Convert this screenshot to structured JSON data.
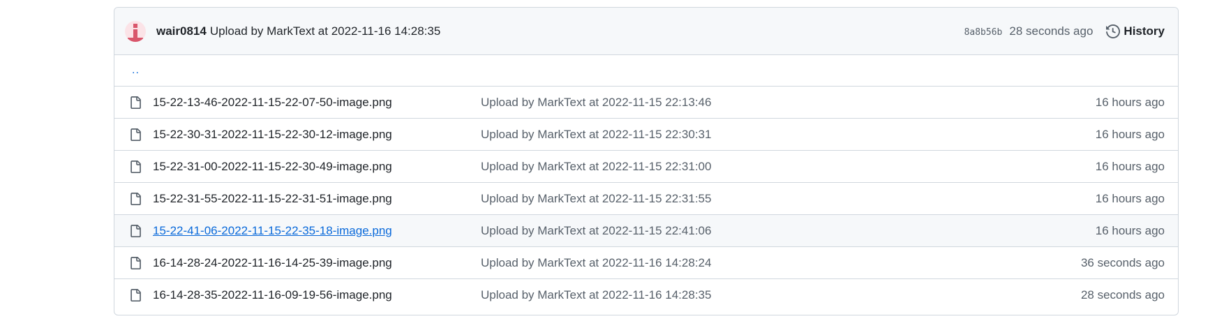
{
  "commit": {
    "author": "wair0814",
    "message": "Upload by MarkText at 2022-11-16 14:28:35",
    "sha": "8a8b56b",
    "age": "28 seconds ago",
    "history_label": "History",
    "avatar_icon": "identicon-avatar"
  },
  "parent_dir": {
    "label": ".."
  },
  "colors": {
    "link": "#0969da",
    "muted": "#57606a",
    "header_bg": "#f6f8fa",
    "border": "#d0d7de",
    "avatar": "#d9566b"
  },
  "files": [
    {
      "name": "15-22-13-46-2022-11-15-22-07-50-image.png",
      "message": "Upload by MarkText at 2022-11-15 22:13:46",
      "age": "16 hours ago",
      "icon": "file-icon"
    },
    {
      "name": "15-22-30-31-2022-11-15-22-30-12-image.png",
      "message": "Upload by MarkText at 2022-11-15 22:30:31",
      "age": "16 hours ago",
      "icon": "file-icon"
    },
    {
      "name": "15-22-31-00-2022-11-15-22-30-49-image.png",
      "message": "Upload by MarkText at 2022-11-15 22:31:00",
      "age": "16 hours ago",
      "icon": "file-icon"
    },
    {
      "name": "15-22-31-55-2022-11-15-22-31-51-image.png",
      "message": "Upload by MarkText at 2022-11-15 22:31:55",
      "age": "16 hours ago",
      "icon": "file-icon"
    },
    {
      "name": "15-22-41-06-2022-11-15-22-35-18-image.png",
      "message": "Upload by MarkText at 2022-11-15 22:41:06",
      "age": "16 hours ago",
      "icon": "file-icon",
      "hovered": true
    },
    {
      "name": "16-14-28-24-2022-11-16-14-25-39-image.png",
      "message": "Upload by MarkText at 2022-11-16 14:28:24",
      "age": "36 seconds ago",
      "icon": "file-icon"
    },
    {
      "name": "16-14-28-35-2022-11-16-09-19-56-image.png",
      "message": "Upload by MarkText at 2022-11-16 14:28:35",
      "age": "28 seconds ago",
      "icon": "file-icon"
    }
  ]
}
